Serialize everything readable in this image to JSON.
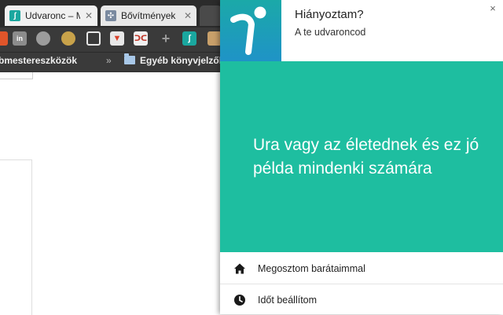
{
  "browser": {
    "tabs": [
      {
        "title": "Udvaronc – M",
        "favicon": "udvaronc-logo-icon",
        "active": true
      },
      {
        "title": "Bővítmények",
        "favicon": "puzzle-icon",
        "active": false
      }
    ],
    "bookmarks": {
      "developer_tools": "bmestereszközök",
      "chevron": "»",
      "other_bookmarks": "Egyéb könyvjelzők"
    }
  },
  "notification": {
    "title": "Hiányoztam?",
    "subtitle": "A te udvaroncod",
    "message": "Ura vagy az életednek és ez jó példa mindenki számára",
    "close_symbol": "×",
    "actions": [
      {
        "label": "Megosztom barátaimmal",
        "icon": "home-icon"
      },
      {
        "label": "Időt beállítom",
        "icon": "clock-icon"
      }
    ]
  },
  "colors": {
    "accent": "#1ebea0",
    "app_icon_top": "#1ba9a8",
    "app_icon_bottom": "#1f93c7"
  }
}
